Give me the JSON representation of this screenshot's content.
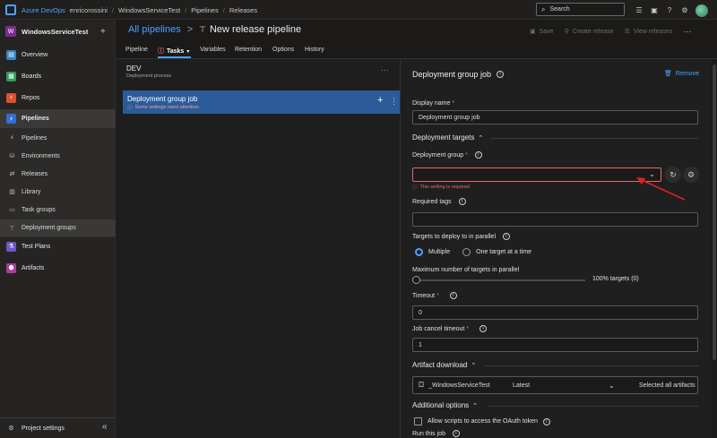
{
  "topbar": {
    "brand": "Azure DevOps",
    "org": "enricorossini",
    "crumbs": [
      "WindowsServiceTest",
      "Pipelines",
      "Releases"
    ],
    "search_placeholder": "Search"
  },
  "sidebar": {
    "project_initial": "W",
    "project_name": "WindowsServiceTest",
    "add_label": "+",
    "items": [
      {
        "label": "Overview"
      },
      {
        "label": "Boards"
      },
      {
        "label": "Repos"
      },
      {
        "label": "Pipelines"
      },
      {
        "label": "Pipelines"
      },
      {
        "label": "Environments"
      },
      {
        "label": "Releases"
      },
      {
        "label": "Library"
      },
      {
        "label": "Task groups"
      },
      {
        "label": "Deployment groups"
      },
      {
        "label": "Test Plans"
      },
      {
        "label": "Artifacts"
      }
    ],
    "settings_label": "Project settings",
    "collapse_label": "«"
  },
  "header": {
    "all_pipelines": "All pipelines",
    "separator": ">",
    "title": "New release pipeline",
    "save": "Save",
    "create_release": "Create release",
    "view_releases": "View releases",
    "more": "···",
    "tabs": [
      "Pipeline",
      "Tasks",
      "Variables",
      "Retention",
      "Options",
      "History"
    ]
  },
  "stage": {
    "name": "DEV",
    "subtitle": "Deployment process",
    "more": "···",
    "job_title": "Deployment group job",
    "job_warning": "Some settings need attention"
  },
  "panel": {
    "title": "Deployment group job",
    "remove": "Remove",
    "display_name_label": "Display name",
    "display_name_value": "Deployment group job",
    "targets_section": "Deployment targets",
    "deployment_group_label": "Deployment group",
    "required_error": "This setting is required",
    "required_tags_label": "Required tags",
    "parallel_label": "Targets to deploy to in parallel",
    "radio_multiple": "Multiple",
    "radio_one": "One target at a time",
    "max_targets_label": "Maximum number of targets in parallel",
    "max_targets_value": "100% targets (0)",
    "timeout_label": "Timeout",
    "timeout_value": "0",
    "cancel_timeout_label": "Job cancel timeout",
    "cancel_timeout_value": "1",
    "artifact_section": "Artifact download",
    "artifact_name": "_WindowsServiceTest",
    "artifact_version": "Latest",
    "artifact_selection": "Selected all artifacts",
    "additional_section": "Additional options",
    "oauth_label": "Allow scripts to access the OAuth token",
    "run_job_label": "Run this job",
    "required_marker": "*"
  },
  "colors": {
    "accent": "#4aa3ff",
    "error": "#e06c6c",
    "selected_job": "#2b5b99",
    "arrow": "#e0211f"
  }
}
